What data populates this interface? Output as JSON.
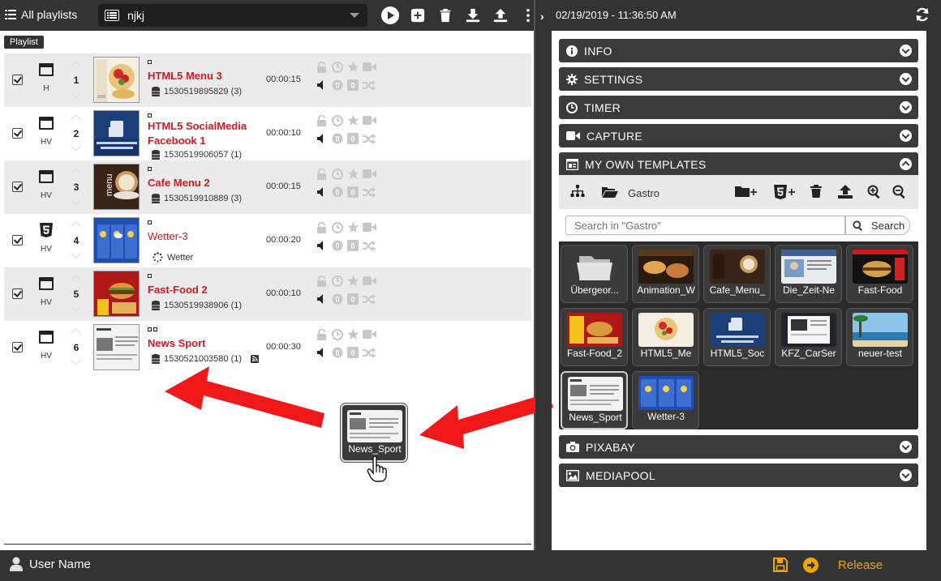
{
  "toolbar": {
    "all_playlists_label": "All playlists",
    "playlist_select_value": "njkj",
    "tooltip": "Playlist"
  },
  "playlist": {
    "rows": [
      {
        "type": "H",
        "number": "1",
        "title": "HTML5 Menu 3",
        "sub": "1530519895829 (3)",
        "duration": "00:00:15",
        "sub_icon": "database-icon"
      },
      {
        "type": "HV",
        "number": "2",
        "title": "HTML5 SocialMedia Facebook 1",
        "sub": "1530519906057 (1)",
        "duration": "00:00:10",
        "sub_icon": "database-icon"
      },
      {
        "type": "HV",
        "number": "3",
        "title": "Cafe Menu 2",
        "sub": "1530519910889 (3)",
        "duration": "00:00:15",
        "sub_icon": "database-icon"
      },
      {
        "type": "HV",
        "number": "4",
        "title": "Wetter-3",
        "sub": "Wetter",
        "duration": "00:00:20",
        "sub_icon": "spinner-icon"
      },
      {
        "type": "HV",
        "number": "5",
        "title": "Fast-Food 2",
        "sub": "1530519938906 (1)",
        "duration": "00:00:10",
        "sub_icon": "database-icon"
      },
      {
        "type": "HV",
        "number": "6",
        "title": "News Sport",
        "sub": "1530521003580 (1)",
        "duration": "00:00:30",
        "sub_icon": "database-icon"
      }
    ]
  },
  "right_panel": {
    "datetime": "02/19/2019 - 11:36:50 AM",
    "sections": {
      "info": "INFO",
      "settings": "SETTINGS",
      "timer": "TIMER",
      "capture": "CAPTURE",
      "templates": "MY OWN TEMPLATES",
      "pixabay": "PIXABAY",
      "mediapool": "MEDIAPOOL"
    },
    "templates": {
      "folder": "Gastro",
      "search_placeholder": "Search in \"Gastro\"",
      "search_button": "Search",
      "tiles": [
        {
          "name": "Übergeor..."
        },
        {
          "name": "Animation_W"
        },
        {
          "name": "Cafe_Menu_"
        },
        {
          "name": "Die_Zeit-Ne"
        },
        {
          "name": "Fast-Food"
        },
        {
          "name": "Fast-Food_2"
        },
        {
          "name": "HTML5_Me"
        },
        {
          "name": "HTML5_Soc"
        },
        {
          "name": "KFZ_CarSer"
        },
        {
          "name": "neuer-test"
        },
        {
          "name": "News_Sport"
        },
        {
          "name": "Wetter-3"
        }
      ]
    }
  },
  "drag": {
    "tile_name": "News_Sport"
  },
  "footer": {
    "user": "User Name",
    "release": "Release"
  },
  "colors": {
    "accent_red": "#e0141e",
    "release_orange": "#f0a500",
    "dark_bar": "#333333"
  }
}
